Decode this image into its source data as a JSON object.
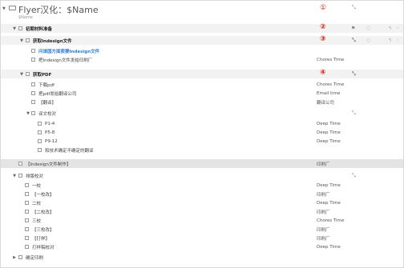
{
  "header": {
    "title": "Flyer汉化：$Name",
    "subtitle": "$Name"
  },
  "markers": [
    "①",
    "②",
    "③",
    "④"
  ],
  "expand_glyph": "⤡",
  "rows": [
    {
      "label": "初期材料准备",
      "context": ""
    },
    {
      "label": "获取Indesign文件",
      "context": ""
    },
    {
      "label": "问谁国方面索要Indesign文件",
      "context": ""
    },
    {
      "label": "把Indesign文件发给印刷厂",
      "context": "Chores Time"
    },
    {
      "label": "获取PDF",
      "context": ""
    },
    {
      "label": "下载pdf",
      "context": "Chores Time"
    },
    {
      "label": "把pdf发给翻译公司",
      "context": "Email time"
    },
    {
      "label": "【翻译】",
      "context": "翻译公司"
    },
    {
      "label": "译文校对",
      "context": ""
    },
    {
      "label": "P1-4",
      "context": "Deep Time"
    },
    {
      "label": "P5-8",
      "context": "Deep Time"
    },
    {
      "label": "P9-12",
      "context": "Deep Time"
    },
    {
      "label": "和技术确定不确定的翻译",
      "context": ""
    },
    {
      "label": "【Indesign文件制作】",
      "context": "印刷厂"
    },
    {
      "label": "排版校对",
      "context": ""
    },
    {
      "label": "一校",
      "context": "Deep Time"
    },
    {
      "label": "【一校改】",
      "context": "印刷厂"
    },
    {
      "label": "二校",
      "context": "Deep Time"
    },
    {
      "label": "【二校改】",
      "context": "印刷厂"
    },
    {
      "label": "三校",
      "context": "Chores Time"
    },
    {
      "label": "【三校改】",
      "context": "印刷厂"
    },
    {
      "label": "【打样】",
      "context": "印刷厂"
    },
    {
      "label": "打样稿校对",
      "context": "Deep Time"
    },
    {
      "label": "确定印刷",
      "context": ""
    }
  ]
}
